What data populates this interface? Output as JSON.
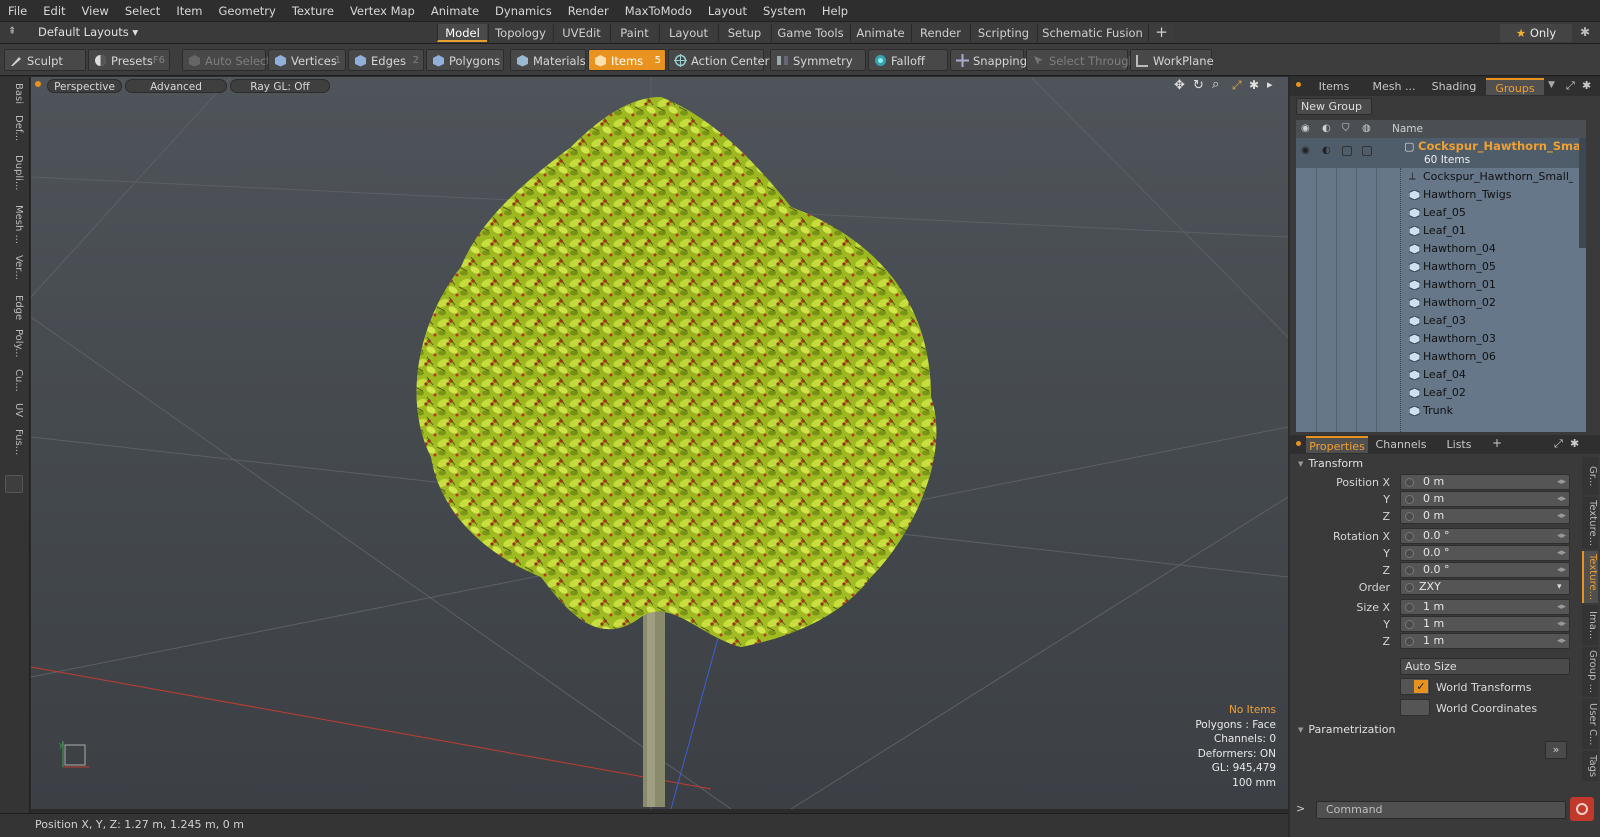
{
  "menu": [
    "File",
    "Edit",
    "View",
    "Select",
    "Item",
    "Geometry",
    "Texture",
    "Vertex Map",
    "Animate",
    "Dynamics",
    "Render",
    "MaxToModo",
    "Layout",
    "System",
    "Help"
  ],
  "layoutbar": {
    "layout_dropdown": "Default Layouts",
    "tabs": [
      "Model",
      "Topology",
      "UVEdit",
      "Paint",
      "Layout",
      "Setup",
      "Game Tools",
      "Animate",
      "Render",
      "Scripting",
      "Schematic Fusion"
    ],
    "active_tab": "Model",
    "only_label": "Only"
  },
  "toolbar": {
    "sculpt": "Sculpt",
    "presets": "Presets",
    "presets_key": "F6",
    "auto_select": "Auto Select",
    "vertices": "Vertices",
    "vertices_key": "1",
    "edges": "Edges",
    "edges_key": "2",
    "polygons": "Polygons",
    "materials": "Materials",
    "items": "Items",
    "items_key": "5",
    "action_center": "Action Center",
    "symmetry": "Symmetry",
    "falloff": "Falloff",
    "snapping": "Snapping",
    "select_through": "Select Through",
    "workplane": "WorkPlane"
  },
  "left_tabs": [
    "Basi",
    "Def...",
    "Dupli...",
    "Mesh ...",
    "Ver...",
    "Edge",
    "Poly...",
    "Cu...",
    "UV",
    "Fus..."
  ],
  "viewport": {
    "perspective": "Perspective",
    "advanced": "Advanced",
    "raygl": "Ray GL: Off",
    "info": {
      "no_items": "No Items",
      "polygons": "Polygons : Face",
      "channels": "Channels: 0",
      "deformers": "Deformers: ON",
      "gl": "GL: 945,479",
      "scale": "100 mm"
    }
  },
  "status": {
    "position": "Position X, Y, Z:   1.27 m, 1.245 m, 0 m"
  },
  "right_panel": {
    "top_tabs": [
      "Items",
      "Mesh ...",
      "Shading",
      "Groups"
    ],
    "active_top_tab": "Groups",
    "new_group": "New Group",
    "name_header": "Name",
    "group_name": "Cockspur_Hawthorn_Sma...",
    "group_count": "60 Items",
    "items": [
      "Cockspur_Hawthorn_Small_...",
      "Hawthorn_Twigs",
      "Leaf_05",
      "Leaf_01",
      "Hawthorn_04",
      "Hawthorn_05",
      "Hawthorn_01",
      "Hawthorn_02",
      "Leaf_03",
      "Hawthorn_03",
      "Hawthorn_06",
      "Leaf_04",
      "Leaf_02",
      "Trunk"
    ],
    "prop_tabs": [
      "Properties",
      "Channels",
      "Lists"
    ],
    "active_prop_tab": "Properties",
    "transform": "Transform",
    "position_x_label": "Position X",
    "y_label": "Y",
    "z_label": "Z",
    "position": [
      "0 m",
      "0 m",
      "0 m"
    ],
    "rotation_x_label": "Rotation X",
    "rotation": [
      "0.0 °",
      "0.0 °",
      "0.0 °"
    ],
    "order_label": "Order",
    "order_value": "ZXY",
    "size_x_label": "Size X",
    "size": [
      "1 m",
      "1 m",
      "1 m"
    ],
    "auto_size": "Auto Size",
    "world_transforms": "World Transforms",
    "world_coordinates": "World Coordinates",
    "parametrization": "Parametrization",
    "side_tabs": [
      "Gr...",
      "Texture...",
      "Texture...",
      "Ima...",
      "Group ...",
      "User C...",
      "Tags"
    ],
    "command_placeholder": "Command"
  }
}
